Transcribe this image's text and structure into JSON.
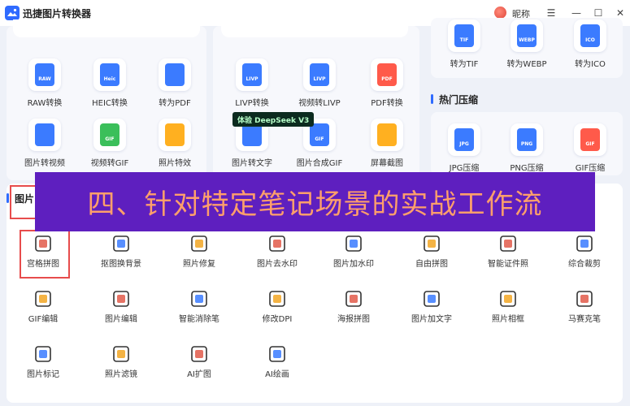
{
  "app": {
    "title": "迅捷图片转换器",
    "user": "昵称"
  },
  "window_controls": {
    "menu": "☰",
    "minimize": "—",
    "maximize": "☐",
    "close": "✕"
  },
  "panel_left_tools": [
    {
      "label": "RAW转换",
      "icon": "raw-icon",
      "badge": "RAW",
      "color": "#3b7bff"
    },
    {
      "label": "HEIC转换",
      "icon": "heic-icon",
      "badge": "Heic",
      "color": "#3b7bff"
    },
    {
      "label": "转为PDF",
      "icon": "pdf-convert-icon",
      "badge": "",
      "color": "#3b7bff"
    },
    {
      "label": "图片转视频",
      "icon": "image-to-video-icon",
      "badge": "",
      "color": "#3b7bff"
    },
    {
      "label": "视频转GIF",
      "icon": "video-to-gif-icon",
      "badge": "GIF",
      "color": "#3bbf5a"
    },
    {
      "label": "照片特效",
      "icon": "photo-effect-icon",
      "badge": "",
      "color": "#ffb020"
    }
  ],
  "panel_mid_tools": [
    {
      "label": "LIVP转换",
      "icon": "livp-icon",
      "badge": "LIVP",
      "color": "#3b7bff"
    },
    {
      "label": "视频转LIVP",
      "icon": "video-to-livp-icon",
      "badge": "LIVP",
      "color": "#3b7bff"
    },
    {
      "label": "PDF转换",
      "icon": "pdf-icon",
      "badge": "PDF",
      "color": "#ff5a4a"
    },
    {
      "label": "图片转文字",
      "icon": "image-to-text-icon",
      "badge": "",
      "color": "#3b7bff"
    },
    {
      "label": "图片合成GIF",
      "icon": "gif-compose-icon",
      "badge": "GIF",
      "color": "#3b7bff"
    },
    {
      "label": "屏幕截图",
      "icon": "screenshot-icon",
      "badge": "",
      "color": "#ffb020"
    }
  ],
  "deepseek_badge": "体验 DeepSeek V3",
  "panel_right_top_tools": [
    {
      "label": "转为TIF",
      "icon": "tif-icon",
      "badge": "TIF",
      "color": "#3b7bff"
    },
    {
      "label": "转为WEBP",
      "icon": "webp-icon",
      "badge": "WEBP",
      "color": "#3b7bff"
    },
    {
      "label": "转为ICO",
      "icon": "ico-icon",
      "badge": "ICO",
      "color": "#3b7bff"
    }
  ],
  "compress_section": {
    "title": "热门压缩",
    "tools": [
      {
        "label": "JPG压缩",
        "icon": "jpg-compress-icon",
        "badge": "JPG",
        "color": "#3b7bff"
      },
      {
        "label": "PNG压缩",
        "icon": "png-compress-icon",
        "badge": "PNG",
        "color": "#3b7bff"
      },
      {
        "label": "GIF压缩",
        "icon": "gif-compress-icon",
        "badge": "GIF",
        "color": "#ff5a4a"
      }
    ]
  },
  "edit_section": {
    "title": "图片",
    "tools": [
      {
        "label": "宫格拼图",
        "icon": "grid-collage-icon"
      },
      {
        "label": "抠图换背景",
        "icon": "cutout-background-icon"
      },
      {
        "label": "照片修复",
        "icon": "photo-repair-icon"
      },
      {
        "label": "图片去水印",
        "icon": "remove-watermark-icon"
      },
      {
        "label": "图片加水印",
        "icon": "add-watermark-icon"
      },
      {
        "label": "自由拼图",
        "icon": "free-collage-icon"
      },
      {
        "label": "智能证件照",
        "icon": "id-photo-icon"
      },
      {
        "label": "综合裁剪",
        "icon": "crop-icon"
      },
      {
        "label": "GIF编辑",
        "icon": "gif-edit-icon"
      },
      {
        "label": "图片编辑",
        "icon": "image-edit-icon"
      },
      {
        "label": "智能消除笔",
        "icon": "eraser-pen-icon"
      },
      {
        "label": "修改DPI",
        "icon": "dpi-icon"
      },
      {
        "label": "海报拼图",
        "icon": "poster-collage-icon"
      },
      {
        "label": "图片加文字",
        "icon": "add-text-icon"
      },
      {
        "label": "照片相框",
        "icon": "photo-frame-icon"
      },
      {
        "label": "马赛克笔",
        "icon": "mosaic-pen-icon"
      },
      {
        "label": "图片标记",
        "icon": "image-mark-icon"
      },
      {
        "label": "照片滤镜",
        "icon": "photo-filter-icon"
      },
      {
        "label": "AI扩图",
        "icon": "ai-expand-icon"
      },
      {
        "label": "AI绘画",
        "icon": "ai-paint-icon"
      }
    ]
  },
  "overlay_caption": "四、针对特定笔记场景的实战工作流",
  "colors": {
    "accent": "#2f6bff",
    "overlay_bg": "#5e1fbf",
    "overlay_text": "#ff9f6b",
    "highlight": "#e74c4c"
  }
}
